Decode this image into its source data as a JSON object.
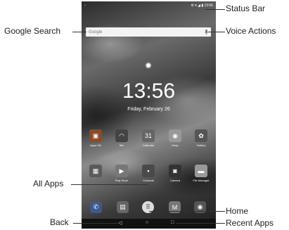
{
  "status_bar": {
    "left": "▫",
    "right": "⚙ ▾ ◢ ▮ 13:56"
  },
  "search": {
    "placeholder": "Google"
  },
  "clock": {
    "time": "13:56",
    "date": "Friday, February 26"
  },
  "apps_row1": [
    {
      "label": "Apps HD",
      "icon": "briefcase-icon",
      "color": "#8a4b2a"
    },
    {
      "label": "Mix",
      "icon": "headphones-icon",
      "color": "#444"
    },
    {
      "label": "Calendar",
      "icon": "calendar-icon",
      "color": "#666"
    },
    {
      "label": "Keep",
      "icon": "bulb-icon",
      "color": "#999"
    },
    {
      "label": "Gallery",
      "icon": "flower-icon",
      "color": "#555"
    }
  ],
  "apps_row2": [
    {
      "label": "",
      "icon": "folder-grid-icon",
      "color": "#5a5a5a"
    },
    {
      "label": "Play Store",
      "icon": "play-store-icon",
      "color": "#777"
    },
    {
      "label": "Contacts",
      "icon": "contacts-icon",
      "color": "#4a4a4a"
    },
    {
      "label": "Camera",
      "icon": "camera-icon",
      "color": "#333"
    },
    {
      "label": "File Manager",
      "icon": "folder-icon",
      "color": "#999"
    }
  ],
  "dock": [
    {
      "icon": "phone-icon",
      "glyph": "✆",
      "color": "#3d5a8a"
    },
    {
      "icon": "messages-icon",
      "glyph": "▤",
      "color": "#666"
    },
    {
      "icon": "all-apps-icon",
      "glyph": "⠿",
      "color": "#ddd"
    },
    {
      "icon": "gmail-icon",
      "glyph": "M",
      "color": "#777"
    },
    {
      "icon": "chrome-icon",
      "glyph": "◉",
      "color": "#555"
    }
  ],
  "navbar": {
    "back": "◁",
    "home": "○",
    "recent": "□"
  },
  "callouts": {
    "status_bar": "Status Bar",
    "google_search": "Google Search",
    "voice_actions": "Voice Actions",
    "all_apps": "All Apps",
    "home": "Home",
    "back": "Back",
    "recent_apps": "Recent Apps"
  }
}
